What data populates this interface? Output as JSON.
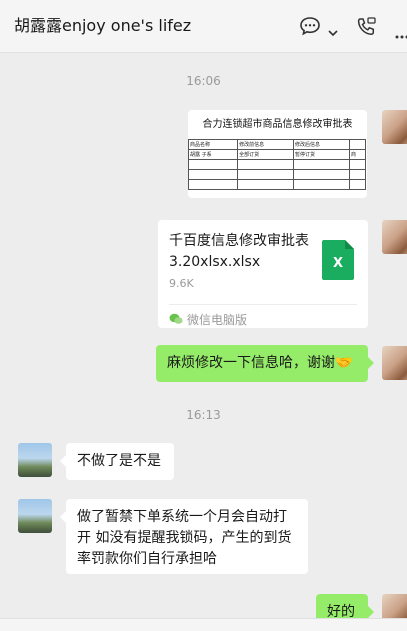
{
  "header": {
    "title": "胡露露enjoy one's lifez",
    "icons": [
      "chat-bubble-icon",
      "chevron-down-icon",
      "phone-icon",
      "more-icon"
    ]
  },
  "messages": {
    "time1": "16:06",
    "image_doc": {
      "title": "合力连锁超市商品信息修改审批表",
      "col_headers": [
        "商品名称",
        "修改前信息",
        "修改后信息"
      ],
      "row1": [
        "胡露 子系",
        "全部订货",
        "暂停订货",
        "商"
      ]
    },
    "file": {
      "name": "千百度信息修改审批表3.20xlsx.xlsx",
      "size": "9.6K",
      "source": "微信电脑版",
      "icon_letter": "X"
    },
    "green1": "麻烦修改一下信息哈，谢谢🤝",
    "time2": "16:13",
    "left1": "不做了是不是",
    "left2": "做了暂禁下单系统一个月会自动打开  如没有提醒我锁码，产生的到货率罚款你们自行承担哈",
    "green2": "好的"
  },
  "colors": {
    "green_bubble": "#95ec69",
    "background": "#ededed",
    "excel_green": "#1aad5f"
  }
}
